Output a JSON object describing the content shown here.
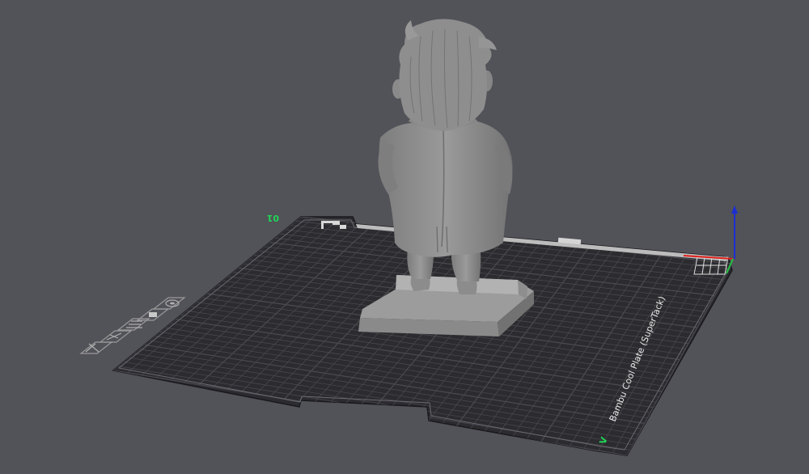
{
  "viewport": {
    "background": "#525259"
  },
  "plate": {
    "name": "Bambu Cool Plate (SuperTack)",
    "plate_number": "01",
    "id_mark": "V",
    "surface_color": "#2c2c30",
    "grid_color": "#4a4a50",
    "icons": [
      "close-icon",
      "arrange-icon",
      "plate-settings-icon",
      "lock-icon",
      "orient-icon"
    ]
  },
  "model": {
    "color": "#8f8f8f",
    "kind": "figurine on pedestal"
  },
  "axes": {
    "x_color": "#e0211c",
    "y_color": "#23c343",
    "z_color": "#1b2fd1"
  }
}
